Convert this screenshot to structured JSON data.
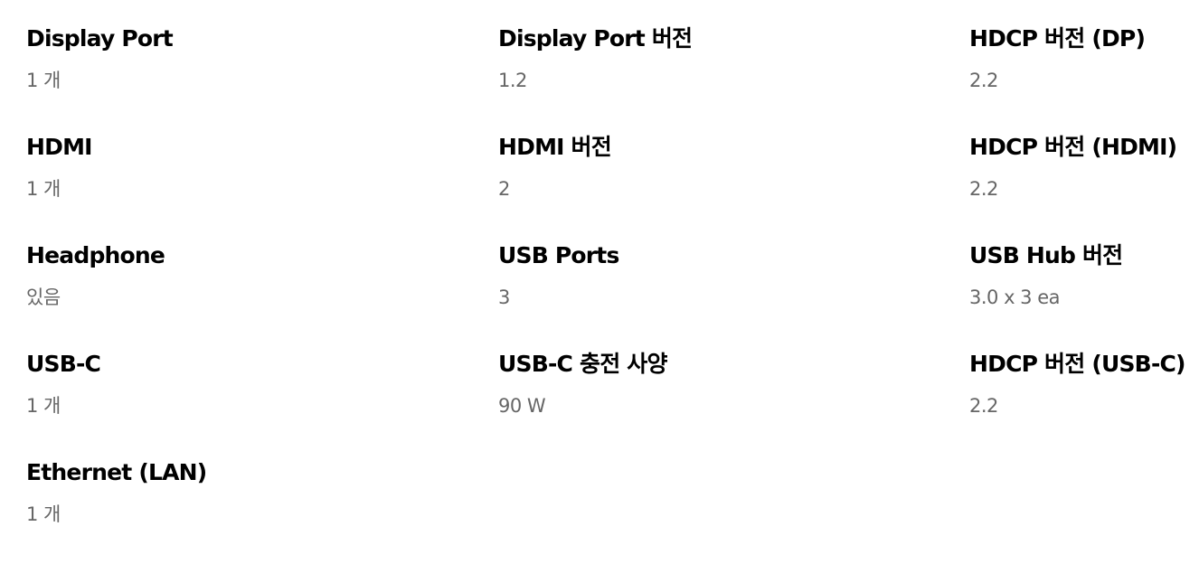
{
  "specs": [
    {
      "label": "Display Port",
      "value": "1 개"
    },
    {
      "label": "Display Port 버전",
      "value": "1.2"
    },
    {
      "label": "HDCP 버전 (DP)",
      "value": "2.2"
    },
    {
      "label": "HDMI",
      "value": "1 개"
    },
    {
      "label": "HDMI 버전",
      "value": "2"
    },
    {
      "label": "HDCP 버전 (HDMI)",
      "value": "2.2"
    },
    {
      "label": "Headphone",
      "value": "있음"
    },
    {
      "label": "USB Ports",
      "value": "3"
    },
    {
      "label": "USB Hub 버전",
      "value": "3.0 x 3 ea"
    },
    {
      "label": "USB-C",
      "value": "1 개"
    },
    {
      "label": "USB-C 충전 사양",
      "value": "90 W"
    },
    {
      "label": "HDCP 버전 (USB-C)",
      "value": "2.2"
    },
    {
      "label": "Ethernet (LAN)",
      "value": "1 개"
    }
  ]
}
